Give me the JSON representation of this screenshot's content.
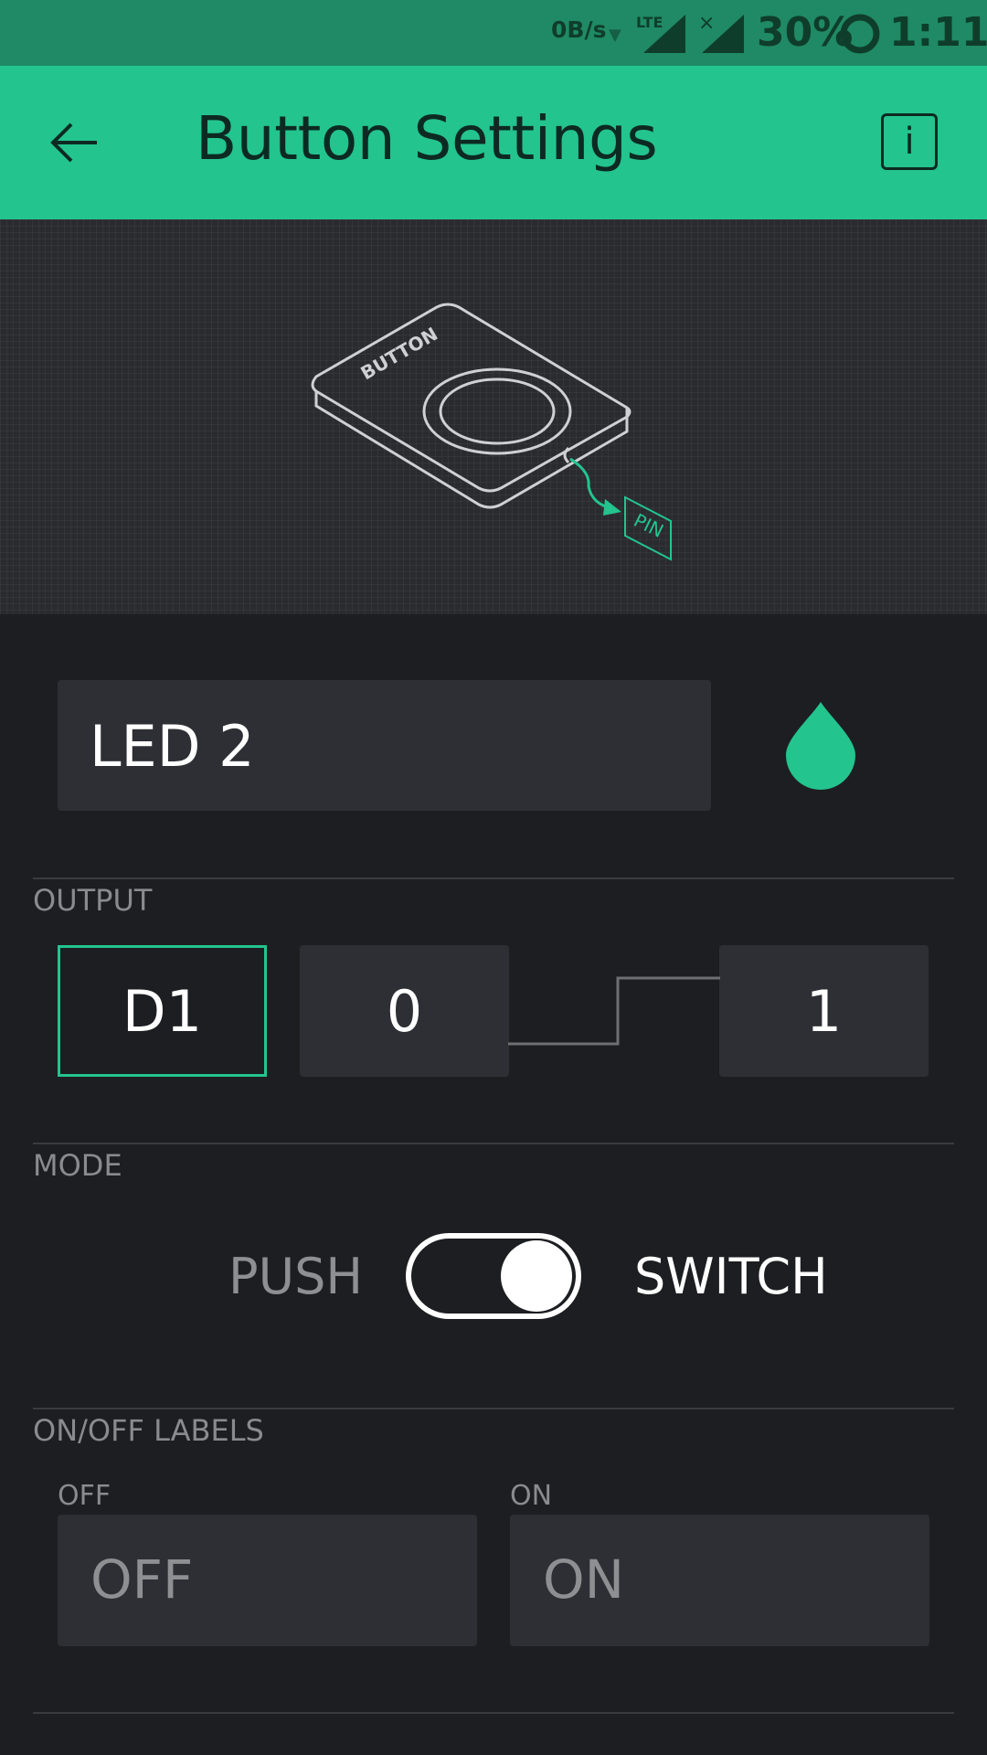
{
  "status_bar": {
    "network_speed": "0B/s",
    "network_type": "LTE",
    "battery": "30%",
    "time": "1:11"
  },
  "app_bar": {
    "title": "Button Settings",
    "info_label": "i"
  },
  "illustration": {
    "device_label": "BUTTON",
    "pin_label": "PIN"
  },
  "widget": {
    "name": "LED 2",
    "color": "#23c48e"
  },
  "output": {
    "section_label": "OUTPUT",
    "pin": "D1",
    "low_value": "0",
    "high_value": "1"
  },
  "mode": {
    "section_label": "MODE",
    "push_label": "PUSH",
    "switch_label": "SWITCH",
    "selected": "SWITCH"
  },
  "labels": {
    "section_label": "ON/OFF LABELS",
    "off_caption": "OFF",
    "on_caption": "ON",
    "off_placeholder": "OFF",
    "on_placeholder": "ON"
  },
  "colors": {
    "accent": "#23c48e",
    "status_bar": "#1f8a65",
    "background": "#1d1e22"
  }
}
